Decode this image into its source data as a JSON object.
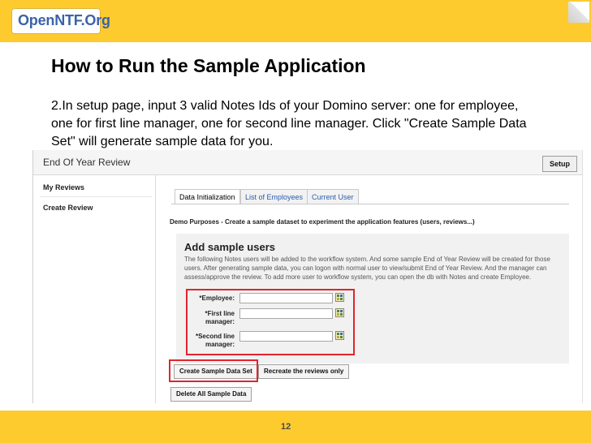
{
  "header": {
    "logo_text": "OpenNTF.Org"
  },
  "slide": {
    "title": "How to Run the Sample Application",
    "instructions": "2.In setup page, input 3 valid Notes Ids of your Domino server: one for employee, one for first line manager, one for second line manager. Click \"Create Sample Data Set\" will generate sample data for you."
  },
  "app": {
    "title": "End Of Year Review",
    "setup_label": "Setup",
    "sidebar": [
      {
        "label": "My Reviews"
      },
      {
        "label": "Create Review"
      }
    ],
    "tabs": [
      {
        "label": "Data Initialization",
        "active": true
      },
      {
        "label": "List of Employees",
        "active": false
      },
      {
        "label": "Current User",
        "active": false
      }
    ],
    "demo_text": "Demo Purposes - Create a sample dataset to experiment the application features (users, reviews...)",
    "panel": {
      "title": "Add sample users",
      "description": "The following Notes users will be added to the workflow system. And some sample End of Year Review will be created for those users. After generating sample data, you can logon with normal user to view/submit End of Year Review. And the manager can assess/approve the review. To add more user to workflow system, you can open the db with Notes and create Employee."
    },
    "fields": {
      "employee": {
        "label": "*Employee:",
        "value": ""
      },
      "first_line_manager": {
        "label": "*First line manager:",
        "value": ""
      },
      "second_line_manager": {
        "label": "*Second line manager:",
        "value": ""
      }
    },
    "buttons": {
      "create_sample": "Create Sample Data Set",
      "recreate_reviews": "Recreate the reviews only",
      "delete_all": "Delete All Sample Data"
    }
  },
  "footer": {
    "page_number": "12"
  },
  "colors": {
    "brand_yellow": "#fecb2f",
    "highlight_red": "#e2242d",
    "link_blue": "#2a5db0"
  }
}
